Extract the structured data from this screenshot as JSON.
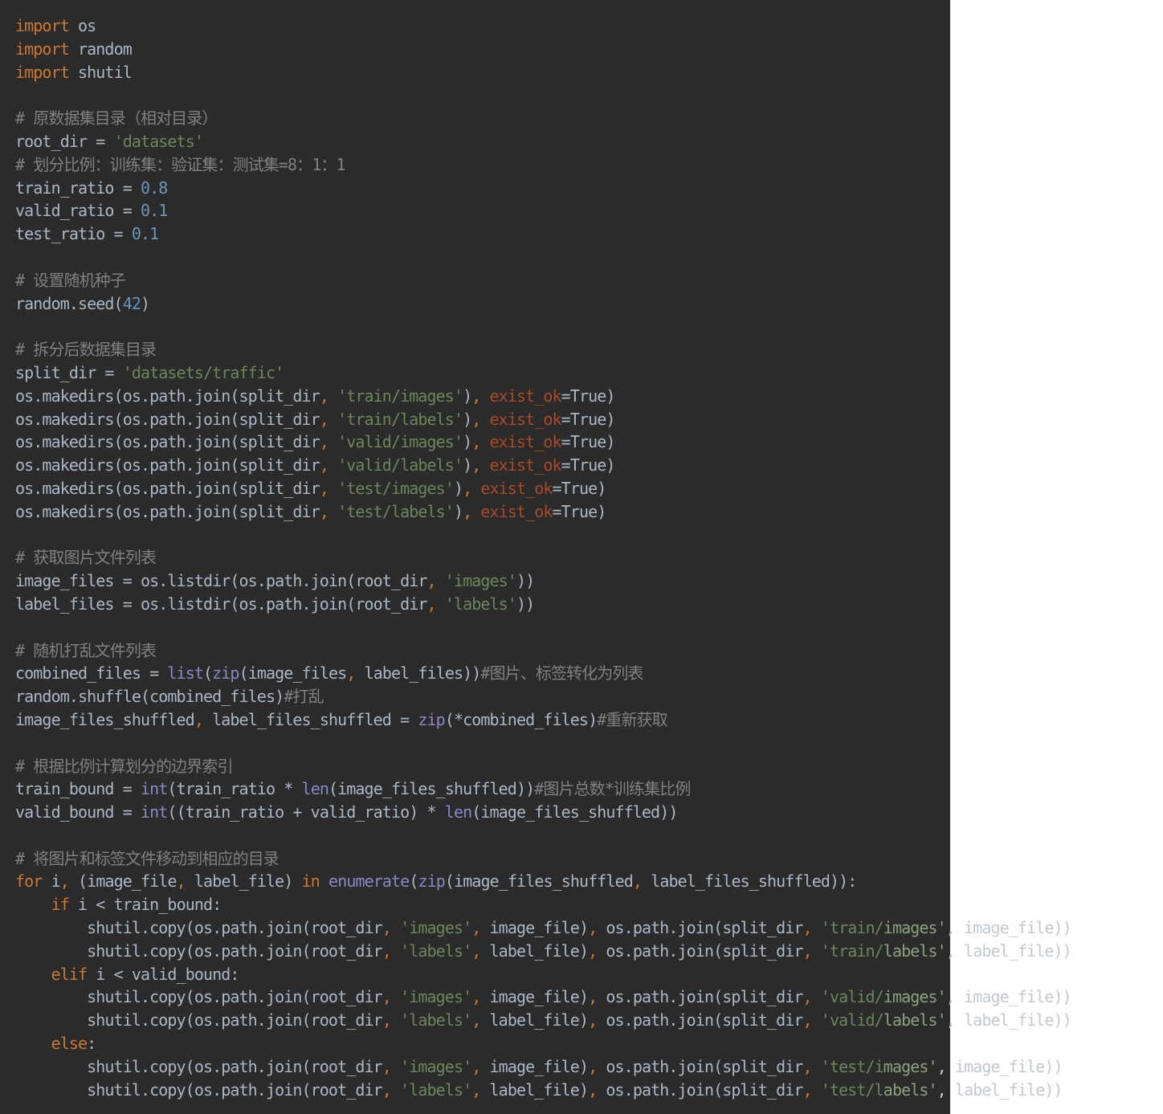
{
  "code": {
    "lines": [
      [
        {
          "t": "import",
          "c": "kw"
        },
        {
          "t": " os",
          "c": "df"
        }
      ],
      [
        {
          "t": "import",
          "c": "kw"
        },
        {
          "t": " random",
          "c": "df"
        }
      ],
      [
        {
          "t": "import",
          "c": "kw"
        },
        {
          "t": " shutil",
          "c": "df"
        }
      ],
      [],
      [
        {
          "t": "# 原数据集目录（相对目录）",
          "c": "cm"
        }
      ],
      [
        {
          "t": "root_dir = ",
          "c": "df"
        },
        {
          "t": "'datasets'",
          "c": "st"
        }
      ],
      [
        {
          "t": "# 划分比例：训练集：验证集：测试集=8：1：1",
          "c": "cm"
        }
      ],
      [
        {
          "t": "train_ratio = ",
          "c": "df"
        },
        {
          "t": "0.8",
          "c": "nm"
        }
      ],
      [
        {
          "t": "valid_ratio = ",
          "c": "df"
        },
        {
          "t": "0.1",
          "c": "nm"
        }
      ],
      [
        {
          "t": "test_ratio = ",
          "c": "df"
        },
        {
          "t": "0.1",
          "c": "nm"
        }
      ],
      [],
      [
        {
          "t": "# 设置随机种子",
          "c": "cm"
        }
      ],
      [
        {
          "t": "random.seed(",
          "c": "df"
        },
        {
          "t": "42",
          "c": "nm"
        },
        {
          "t": ")",
          "c": "df"
        }
      ],
      [],
      [
        {
          "t": "# 拆分后数据集目录",
          "c": "cm"
        }
      ],
      [
        {
          "t": "split_dir = ",
          "c": "df"
        },
        {
          "t": "'datasets/traffic'",
          "c": "st"
        }
      ],
      [
        {
          "t": "os.makedirs(os.path.join(split_dir",
          "c": "df"
        },
        {
          "t": ", ",
          "c": "pn"
        },
        {
          "t": "'train/images'",
          "c": "st"
        },
        {
          "t": ")",
          "c": "df"
        },
        {
          "t": ", ",
          "c": "pn"
        },
        {
          "t": "exist_ok",
          "c": "pr"
        },
        {
          "t": "=True)",
          "c": "df"
        }
      ],
      [
        {
          "t": "os.makedirs(os.path.join(split_dir",
          "c": "df"
        },
        {
          "t": ", ",
          "c": "pn"
        },
        {
          "t": "'train/labels'",
          "c": "st"
        },
        {
          "t": ")",
          "c": "df"
        },
        {
          "t": ", ",
          "c": "pn"
        },
        {
          "t": "exist_ok",
          "c": "pr"
        },
        {
          "t": "=True)",
          "c": "df"
        }
      ],
      [
        {
          "t": "os.makedirs(os.path.join(split_dir",
          "c": "df"
        },
        {
          "t": ", ",
          "c": "pn"
        },
        {
          "t": "'valid/images'",
          "c": "st"
        },
        {
          "t": ")",
          "c": "df"
        },
        {
          "t": ", ",
          "c": "pn"
        },
        {
          "t": "exist_ok",
          "c": "pr"
        },
        {
          "t": "=True)",
          "c": "df"
        }
      ],
      [
        {
          "t": "os.makedirs(os.path.join(split_dir",
          "c": "df"
        },
        {
          "t": ", ",
          "c": "pn"
        },
        {
          "t": "'valid/labels'",
          "c": "st"
        },
        {
          "t": ")",
          "c": "df"
        },
        {
          "t": ", ",
          "c": "pn"
        },
        {
          "t": "exist_ok",
          "c": "pr"
        },
        {
          "t": "=True)",
          "c": "df"
        }
      ],
      [
        {
          "t": "os.makedirs(os.path.join(split_dir",
          "c": "df"
        },
        {
          "t": ", ",
          "c": "pn"
        },
        {
          "t": "'test/images'",
          "c": "st"
        },
        {
          "t": ")",
          "c": "df"
        },
        {
          "t": ", ",
          "c": "pn"
        },
        {
          "t": "exist_ok",
          "c": "pr"
        },
        {
          "t": "=True)",
          "c": "df"
        }
      ],
      [
        {
          "t": "os.makedirs(os.path.join(split_dir",
          "c": "df"
        },
        {
          "t": ", ",
          "c": "pn"
        },
        {
          "t": "'test/labels'",
          "c": "st"
        },
        {
          "t": ")",
          "c": "df"
        },
        {
          "t": ", ",
          "c": "pn"
        },
        {
          "t": "exist_ok",
          "c": "pr"
        },
        {
          "t": "=True)",
          "c": "df"
        }
      ],
      [],
      [
        {
          "t": "# 获取图片文件列表",
          "c": "cm"
        }
      ],
      [
        {
          "t": "image_files = os.listdir(os.path.join(root_dir",
          "c": "df"
        },
        {
          "t": ", ",
          "c": "pn"
        },
        {
          "t": "'images'",
          "c": "st"
        },
        {
          "t": "))",
          "c": "df"
        }
      ],
      [
        {
          "t": "label_files = os.listdir(os.path.join(root_dir",
          "c": "df"
        },
        {
          "t": ", ",
          "c": "pn"
        },
        {
          "t": "'labels'",
          "c": "st"
        },
        {
          "t": "))",
          "c": "df"
        }
      ],
      [],
      [
        {
          "t": "# 随机打乱文件列表",
          "c": "cm"
        }
      ],
      [
        {
          "t": "combined_files = ",
          "c": "df"
        },
        {
          "t": "list",
          "c": "bi"
        },
        {
          "t": "(",
          "c": "df"
        },
        {
          "t": "zip",
          "c": "bi"
        },
        {
          "t": "(image_files",
          "c": "df"
        },
        {
          "t": ", ",
          "c": "pn"
        },
        {
          "t": "label_files))",
          "c": "df"
        },
        {
          "t": "#图片、标签转化为列表",
          "c": "cm"
        }
      ],
      [
        {
          "t": "random.shuffle(combined_files)",
          "c": "df"
        },
        {
          "t": "#打乱",
          "c": "cm"
        }
      ],
      [
        {
          "t": "image_files_shuffled",
          "c": "df"
        },
        {
          "t": ", ",
          "c": "pn"
        },
        {
          "t": "label_files_shuffled = ",
          "c": "df"
        },
        {
          "t": "zip",
          "c": "bi"
        },
        {
          "t": "(*combined_files)",
          "c": "df"
        },
        {
          "t": "#重新获取",
          "c": "cm"
        }
      ],
      [],
      [
        {
          "t": "# 根据比例计算划分的边界索引",
          "c": "cm"
        }
      ],
      [
        {
          "t": "train_bound = ",
          "c": "df"
        },
        {
          "t": "int",
          "c": "bi"
        },
        {
          "t": "(train_ratio * ",
          "c": "df"
        },
        {
          "t": "len",
          "c": "bi"
        },
        {
          "t": "(image_files_shuffled))",
          "c": "df"
        },
        {
          "t": "#图片总数*训练集比例",
          "c": "cm"
        }
      ],
      [
        {
          "t": "valid_bound = ",
          "c": "df"
        },
        {
          "t": "int",
          "c": "bi"
        },
        {
          "t": "((train_ratio + valid_ratio) * ",
          "c": "df"
        },
        {
          "t": "len",
          "c": "bi"
        },
        {
          "t": "(image_files_shuffled))",
          "c": "df"
        }
      ],
      [],
      [
        {
          "t": "# 将图片和标签文件移动到相应的目录",
          "c": "cm"
        }
      ],
      [
        {
          "t": "for",
          "c": "kw"
        },
        {
          "t": " i",
          "c": "df"
        },
        {
          "t": ", ",
          "c": "pn"
        },
        {
          "t": "(image_file",
          "c": "df"
        },
        {
          "t": ", ",
          "c": "pn"
        },
        {
          "t": "label_file) ",
          "c": "df"
        },
        {
          "t": "in",
          "c": "kw"
        },
        {
          "t": " ",
          "c": "df"
        },
        {
          "t": "enumerate",
          "c": "bi"
        },
        {
          "t": "(",
          "c": "df"
        },
        {
          "t": "zip",
          "c": "bi"
        },
        {
          "t": "(image_files_shuffled",
          "c": "df"
        },
        {
          "t": ", ",
          "c": "pn"
        },
        {
          "t": "label_files_shuffled)):",
          "c": "df"
        }
      ],
      [
        {
          "t": "    ",
          "c": "df"
        },
        {
          "t": "if",
          "c": "kw"
        },
        {
          "t": " i < train_bound:",
          "c": "df"
        }
      ],
      [
        {
          "t": "        shutil.copy(os.path.join(root_dir",
          "c": "df"
        },
        {
          "t": ", ",
          "c": "pn"
        },
        {
          "t": "'images'",
          "c": "st"
        },
        {
          "t": ", ",
          "c": "pn"
        },
        {
          "t": "image_file)",
          "c": "df"
        },
        {
          "t": ", ",
          "c": "pn"
        },
        {
          "t": "os.path.join(split_dir",
          "c": "df"
        },
        {
          "t": ", ",
          "c": "pn"
        },
        {
          "t": "'train/",
          "c": "st"
        },
        {
          "t": "images'",
          "c": "lite-st"
        },
        {
          "t": ", image_file))",
          "c": "lite"
        }
      ],
      [
        {
          "t": "        shutil.copy(os.path.join(root_dir",
          "c": "df"
        },
        {
          "t": ", ",
          "c": "pn"
        },
        {
          "t": "'labels'",
          "c": "st"
        },
        {
          "t": ", ",
          "c": "pn"
        },
        {
          "t": "label_file)",
          "c": "df"
        },
        {
          "t": ", ",
          "c": "pn"
        },
        {
          "t": "os.path.join(split_dir",
          "c": "df"
        },
        {
          "t": ", ",
          "c": "pn"
        },
        {
          "t": "'train/",
          "c": "st"
        },
        {
          "t": "labels'",
          "c": "lite-st"
        },
        {
          "t": ", label_file))",
          "c": "lite"
        }
      ],
      [
        {
          "t": "    ",
          "c": "df"
        },
        {
          "t": "elif",
          "c": "kw"
        },
        {
          "t": " i < valid_bound:",
          "c": "df"
        }
      ],
      [
        {
          "t": "        shutil.copy(os.path.join(root_dir",
          "c": "df"
        },
        {
          "t": ", ",
          "c": "pn"
        },
        {
          "t": "'images'",
          "c": "st"
        },
        {
          "t": ", ",
          "c": "pn"
        },
        {
          "t": "image_file)",
          "c": "df"
        },
        {
          "t": ", ",
          "c": "pn"
        },
        {
          "t": "os.path.join(split_dir",
          "c": "df"
        },
        {
          "t": ", ",
          "c": "pn"
        },
        {
          "t": "'valid/",
          "c": "st"
        },
        {
          "t": "images'",
          "c": "lite-st"
        },
        {
          "t": ", image_file))",
          "c": "lite"
        }
      ],
      [
        {
          "t": "        shutil.copy(os.path.join(root_dir",
          "c": "df"
        },
        {
          "t": ", ",
          "c": "pn"
        },
        {
          "t": "'labels'",
          "c": "st"
        },
        {
          "t": ", ",
          "c": "pn"
        },
        {
          "t": "label_file)",
          "c": "df"
        },
        {
          "t": ", ",
          "c": "pn"
        },
        {
          "t": "os.path.join(split_dir",
          "c": "df"
        },
        {
          "t": ", ",
          "c": "pn"
        },
        {
          "t": "'valid/",
          "c": "st"
        },
        {
          "t": "labels'",
          "c": "lite-st"
        },
        {
          "t": ", label_file))",
          "c": "lite"
        }
      ],
      [
        {
          "t": "    ",
          "c": "df"
        },
        {
          "t": "else",
          "c": "kw"
        },
        {
          "t": ":",
          "c": "df"
        }
      ],
      [
        {
          "t": "        shutil.copy(os.path.join(root_dir",
          "c": "df"
        },
        {
          "t": ", ",
          "c": "pn"
        },
        {
          "t": "'images'",
          "c": "st"
        },
        {
          "t": ", ",
          "c": "pn"
        },
        {
          "t": "image_file)",
          "c": "df"
        },
        {
          "t": ", ",
          "c": "pn"
        },
        {
          "t": "os.path.join(split_dir",
          "c": "df"
        },
        {
          "t": ", ",
          "c": "pn"
        },
        {
          "t": "'test/i",
          "c": "st"
        },
        {
          "t": "mages'",
          "c": "lite-st"
        },
        {
          "t": ", image_file))",
          "c": "lite"
        }
      ],
      [
        {
          "t": "        shutil.copy(os.path.join(root_dir",
          "c": "df"
        },
        {
          "t": ", ",
          "c": "pn"
        },
        {
          "t": "'labels'",
          "c": "st"
        },
        {
          "t": ", ",
          "c": "pn"
        },
        {
          "t": "label_file)",
          "c": "df"
        },
        {
          "t": ", ",
          "c": "pn"
        },
        {
          "t": "os.path.join(split_dir",
          "c": "df"
        },
        {
          "t": ", ",
          "c": "pn"
        },
        {
          "t": "'test/l",
          "c": "st"
        },
        {
          "t": "abels'",
          "c": "lite-st"
        },
        {
          "t": ", label_file))",
          "c": "lite"
        }
      ]
    ]
  }
}
